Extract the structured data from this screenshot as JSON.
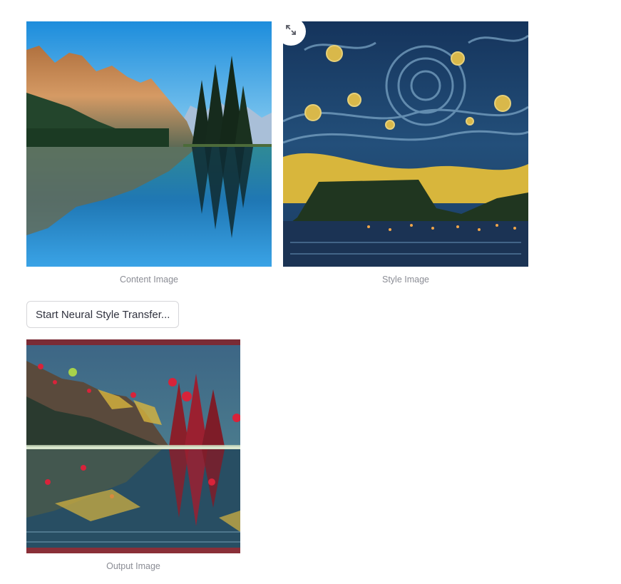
{
  "images": {
    "content": {
      "caption": "Content Image"
    },
    "style": {
      "caption": "Style Image"
    },
    "output": {
      "caption": "Output Image"
    }
  },
  "actions": {
    "start_label": "Start Neural Style Transfer...",
    "expand_icon": "expand-arrows-icon"
  }
}
